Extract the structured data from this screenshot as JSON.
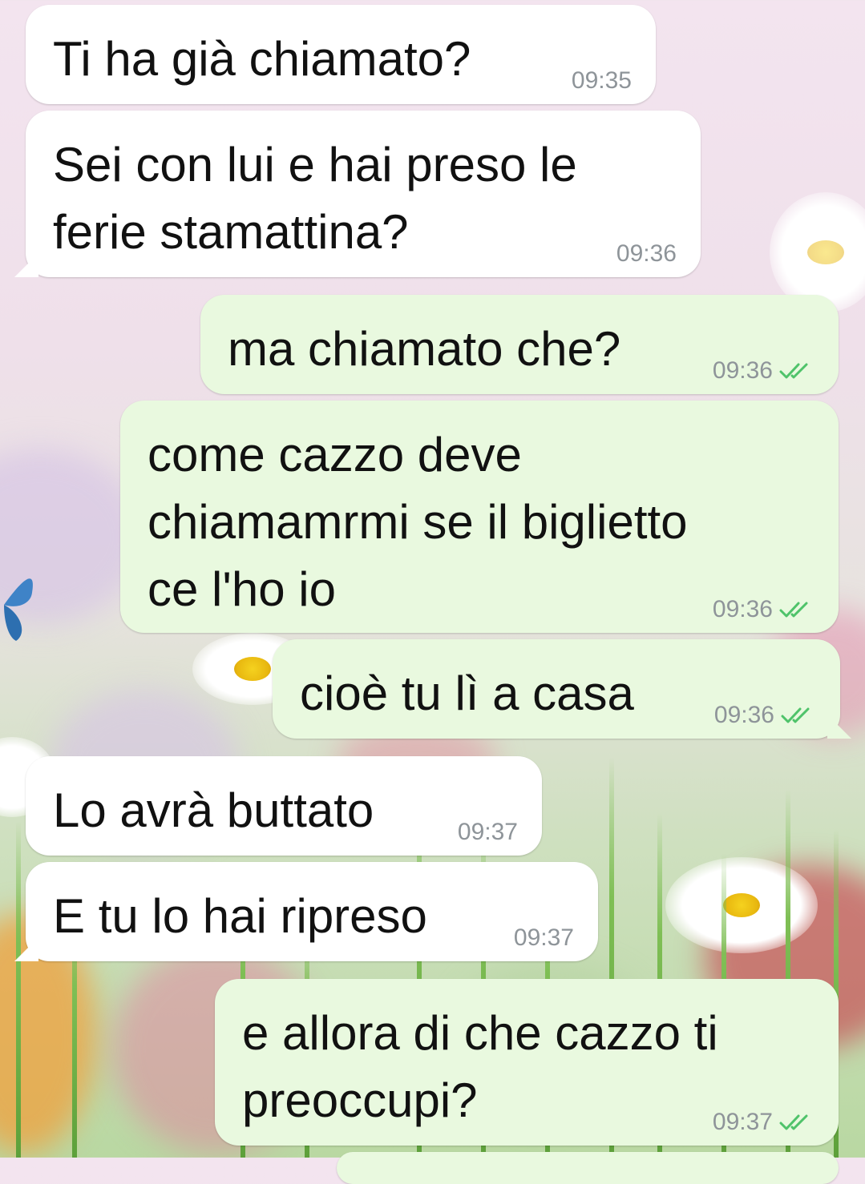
{
  "messages": [
    {
      "id": 1,
      "direction": "incoming",
      "text": "Ti ha già chiamato?",
      "time": "09:35"
    },
    {
      "id": 2,
      "direction": "incoming",
      "text": "Sei con lui e hai preso le\nferie stamattina?",
      "time": "09:36"
    },
    {
      "id": 3,
      "direction": "outgoing",
      "text": "ma chiamato che?",
      "time": "09:36",
      "status": "read-double-check-icon"
    },
    {
      "id": 4,
      "direction": "outgoing",
      "text": "come cazzo deve\nchiamamrmi se il biglietto\nce l'ho io",
      "time": "09:36",
      "status": "read-double-check-icon"
    },
    {
      "id": 5,
      "direction": "outgoing",
      "text": "cioè tu lì a casa",
      "time": "09:36",
      "status": "read-double-check-icon"
    },
    {
      "id": 6,
      "direction": "incoming",
      "text": "Lo avrà buttato",
      "time": "09:37"
    },
    {
      "id": 7,
      "direction": "incoming",
      "text": "E tu lo hai ripreso",
      "time": "09:37"
    },
    {
      "id": 8,
      "direction": "outgoing",
      "text": "e allora di che cazzo ti\npreoccupi?",
      "time": "09:37",
      "status": "read-double-check-icon"
    }
  ],
  "colors": {
    "incoming_bubble": "#ffffff",
    "outgoing_bubble": "#e9f9df",
    "timestamp": "#8e9499",
    "read_ticks": "#4fc36a"
  }
}
